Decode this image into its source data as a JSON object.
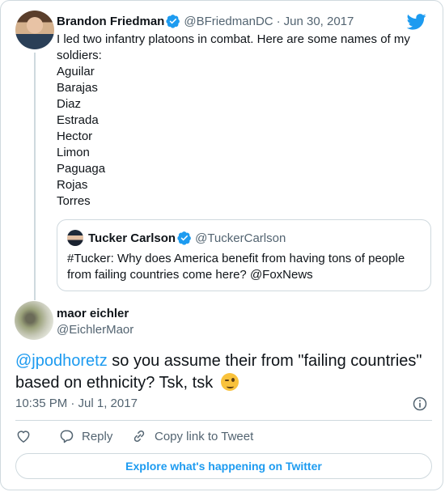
{
  "parent": {
    "display_name": "Brandon Friedman",
    "handle": "@BFriedmanDC",
    "separator": "·",
    "date": "Jun 30, 2017",
    "intro": "I led two infantry platoons in combat. Here are some names of my soldiers:",
    "names": [
      "Aguilar",
      "Barajas",
      "Diaz",
      "Estrada",
      "Hector",
      "Limon",
      "Paguaga",
      "Rojas",
      "Torres"
    ]
  },
  "quoted": {
    "display_name": "Tucker Carlson",
    "handle": "@TuckerCarlson",
    "text": "#Tucker: Why does America benefit from having tons of people from failing countries come here?  @FoxNews"
  },
  "tweet": {
    "display_name": "maor eichler",
    "handle": "@EichlerMaor",
    "mention": "@jpodhoretz",
    "text": " so you assume their from \"failing countries\" based on ethnicity? Tsk, tsk",
    "emoji": "winking-face",
    "timestamp": "10:35 PM · Jul 1, 2017"
  },
  "actions": {
    "reply": "Reply",
    "copy_link": "Copy link to Tweet"
  },
  "explore_label": "Explore what's happening on Twitter",
  "icons": {
    "brand": "twitter-bird-icon",
    "verified": "verified-badge-icon",
    "info": "info-icon",
    "like": "heart-icon",
    "reply": "reply-icon",
    "link": "link-icon"
  },
  "colors": {
    "accent": "#1d9bf0",
    "muted": "#536471",
    "border": "#cfd9de",
    "text": "#0f1419"
  }
}
